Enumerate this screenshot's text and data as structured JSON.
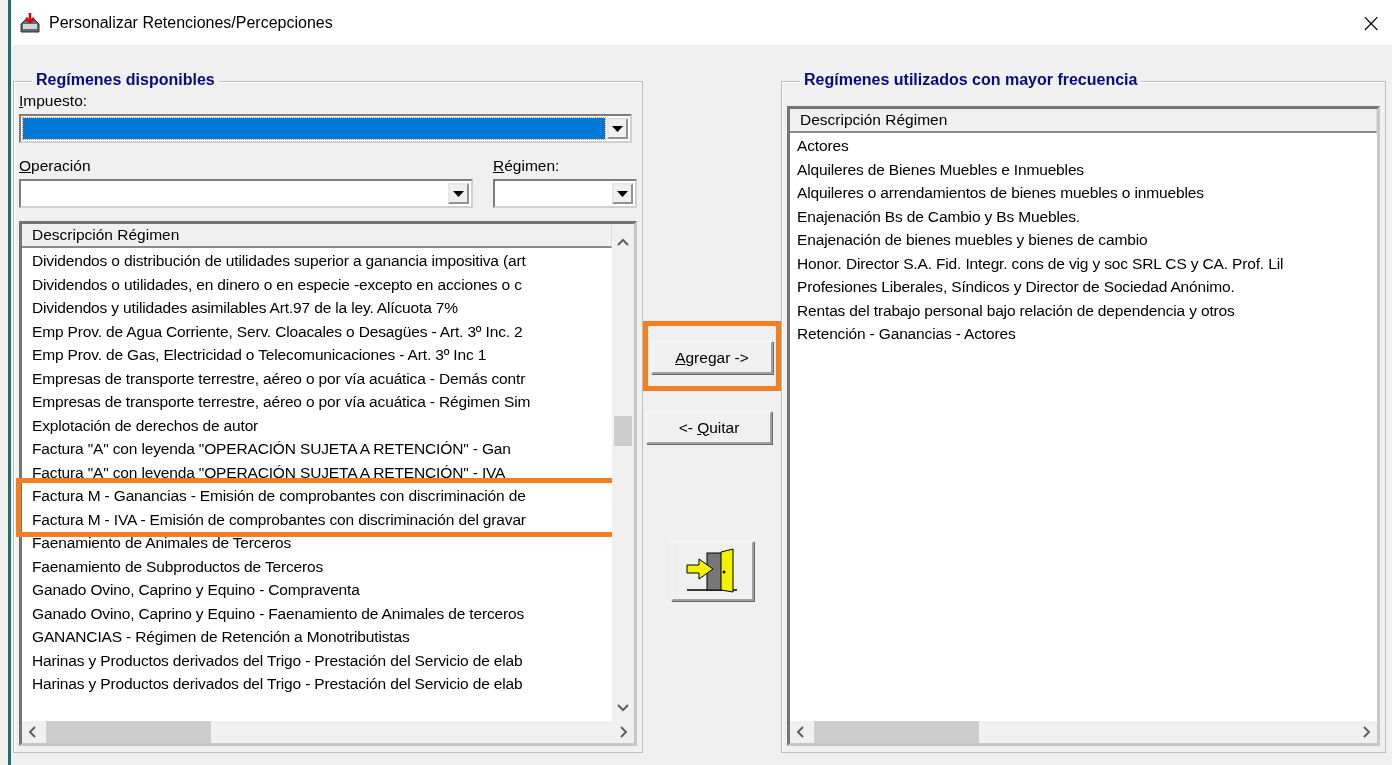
{
  "window": {
    "title": "Personalizar Retenciones/Percepciones",
    "close": "×"
  },
  "available": {
    "title": "Regímenes disponibles",
    "impuesto": {
      "label": "Impuesto:",
      "underline_first": true,
      "focused": true
    },
    "operacion": {
      "label": "Operación",
      "underline_first": true
    },
    "regimen": {
      "label": "Régimen:",
      "underline_first": true
    },
    "list": {
      "column": "Descripción Régimen",
      "rows": [
        {
          "text": "Dividendos o distribución de utilidades superior a ganancia impositiva (art",
          "highlighted": false
        },
        {
          "text": "Dividendos o utilidades, en dinero o en especie -excepto en acciones o c",
          "highlighted": false
        },
        {
          "text": "Dividendos y utilidades asimilables Art.97 de la ley. Alícuota 7%",
          "highlighted": false
        },
        {
          "text": "Emp Prov. de Agua Corriente, Serv. Cloacales o Desagües - Art. 3º Inc. 2",
          "highlighted": false
        },
        {
          "text": "Emp Prov. de Gas, Electricidad o Telecomunicaciones - Art. 3º Inc 1",
          "highlighted": false
        },
        {
          "text": "Empresas de transporte terrestre, aéreo o por vía acuática - Demás contr",
          "highlighted": false
        },
        {
          "text": "Empresas de transporte terrestre, aéreo o por vía acuática - Régimen Sim",
          "highlighted": false
        },
        {
          "text": "Explotación de derechos de autor",
          "highlighted": false
        },
        {
          "text": "Factura \"A\" con leyenda \"OPERACIÓN SUJETA A RETENCIÓN\" - Gan",
          "highlighted": false
        },
        {
          "text": "Factura \"A\" con leyenda \"OPERACIÓN SUJETA A RETENCIÓN\" - IVA",
          "highlighted": false
        },
        {
          "text": "Factura M - Ganancias - Emisión de comprobantes con discriminación de",
          "highlighted": true
        },
        {
          "text": "Factura M - IVA - Emisión de comprobantes con discriminación del gravar",
          "highlighted": true
        },
        {
          "text": "Faenamiento de Animales de Terceros",
          "highlighted": false
        },
        {
          "text": "Faenamiento de Subproductos de Terceros",
          "highlighted": false
        },
        {
          "text": "Ganado Ovino, Caprino y Equino - Compraventa",
          "highlighted": false
        },
        {
          "text": "Ganado Ovino, Caprino y Equino - Faenamiento de Animales de terceros",
          "highlighted": false
        },
        {
          "text": "GANANCIAS - Régimen de Retención a Monotributistas",
          "highlighted": false
        },
        {
          "text": "Harinas y Productos derivados del Trigo - Prestación del Servicio de elab",
          "highlighted": false
        },
        {
          "text": "Harinas y Productos derivados del Trigo - Prestación del Servicio de elab",
          "highlighted": false
        }
      ]
    }
  },
  "actions": [
    {
      "kind": "text",
      "label": "Agregar ->",
      "underline_first": true,
      "highlighted": true
    },
    {
      "kind": "text",
      "prefix": "<- ",
      "label": "Quitar",
      "underline_first": true,
      "highlighted": false
    },
    {
      "kind": "exit"
    }
  ],
  "frequent": {
    "title": "Regímenes utilizados con mayor frecuencia",
    "list": {
      "column": "Descripción Régimen",
      "rows": [
        {
          "text": "Actores",
          "highlighted": false
        },
        {
          "text": "Alquileres de Bienes Muebles e Inmuebles",
          "highlighted": false
        },
        {
          "text": "Alquileres o arrendamientos de bienes muebles o inmuebles",
          "highlighted": false
        },
        {
          "text": "Enajenación Bs de Cambio y Bs Muebles.",
          "highlighted": false
        },
        {
          "text": "Enajenación de bienes muebles y bienes de cambio",
          "highlighted": false
        },
        {
          "text": "Honor. Director S.A. Fid. Integr. cons de vig y soc SRL CS y CA. Prof. Lil",
          "highlighted": false
        },
        {
          "text": "Profesiones Liberales, Síndicos y Director de Sociedad Anónimo.",
          "highlighted": false
        },
        {
          "text": "Rentas del trabajo personal bajo relación de dependencia y otros",
          "highlighted": false
        },
        {
          "text": "Retención - Ganancias - Actores",
          "highlighted": false
        }
      ]
    }
  }
}
